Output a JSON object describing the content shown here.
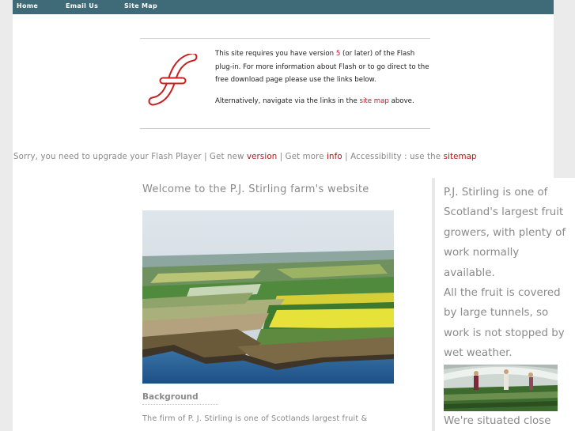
{
  "nav": {
    "home": "Home",
    "email": "Email Us",
    "sitemap": "Site Map"
  },
  "flash": {
    "p1_a": "This site requires you have version ",
    "p1_version": "5",
    "p1_b": " (or later) of the Flash plug-in. For more information about Flash or to go direct to the free download page please use the links below.",
    "p2_a": "Alternatively, navigate via the links in the ",
    "p2_link": "site map",
    "p2_b": " above.",
    "logo_icon": "flash-logo-icon"
  },
  "upgrade": {
    "t1": "Sorry, you need to upgrade your Flash Player | Get new ",
    "version_link": "version",
    "t2": " | Get more ",
    "info_link": "info",
    "t3": " | Accessibility : use the ",
    "sitemap_link": "sitemap"
  },
  "main": {
    "welcome": "Welcome to the P.J. Stirling farm's website",
    "background_heading": "Background",
    "intro": "The firm of P. J. Stirling is one of Scotlands largest fruit &"
  },
  "side": {
    "p1": "P.J. Stirling is one of Scotland's largest fruit growers, with plenty of work normally available.",
    "p2": "All the fruit is covered by large tunnels, so work is not stopped by wet weather.",
    "p3": "We're situated close"
  },
  "colors": {
    "nav_bar": "#3f6b79",
    "link_red": "#b01414",
    "text_grey": "#8a8a8a"
  }
}
